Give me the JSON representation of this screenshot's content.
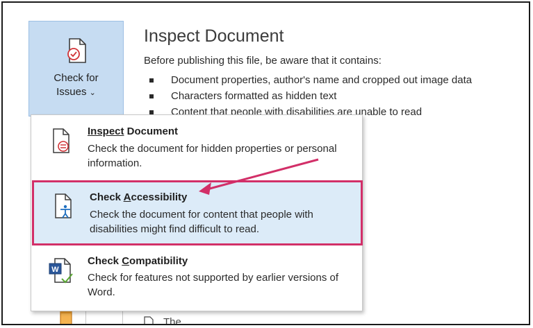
{
  "issues_button": {
    "label_line1": "Check for",
    "label_line2": "Issues",
    "chevron": "⌄",
    "icon": "document-check-icon"
  },
  "inspect_section": {
    "title": "Inspect Document",
    "description": "Before publishing this file, be aware that it contains:",
    "bullets": [
      "Document properties, author's name and cropped out image data",
      "Characters formatted as hidden text",
      "Content that people with disabilities are unable to read"
    ]
  },
  "partial_bottom_text": "The",
  "menu": {
    "items": [
      {
        "title_pre": "Inspect",
        "title_underlined": "",
        "title_post": " Document",
        "description": "Check the document for hidden properties or personal information.",
        "icon": "inspect-document-icon"
      },
      {
        "title_pre": "Check ",
        "title_underlined": "A",
        "title_post": "ccessibility",
        "description": "Check the document for content that people with disabilities might find difficult to read.",
        "icon": "accessibility-icon"
      },
      {
        "title_pre": "Check ",
        "title_underlined": "C",
        "title_post": "ompatibility",
        "description": "Check for features not supported by earlier versions of Word.",
        "icon": "compatibility-icon"
      }
    ]
  },
  "colors": {
    "button_bg": "#c6dcf2",
    "highlight_bg": "#dcebf8",
    "highlight_border": "#d22f68",
    "arrow": "#d22f68"
  }
}
